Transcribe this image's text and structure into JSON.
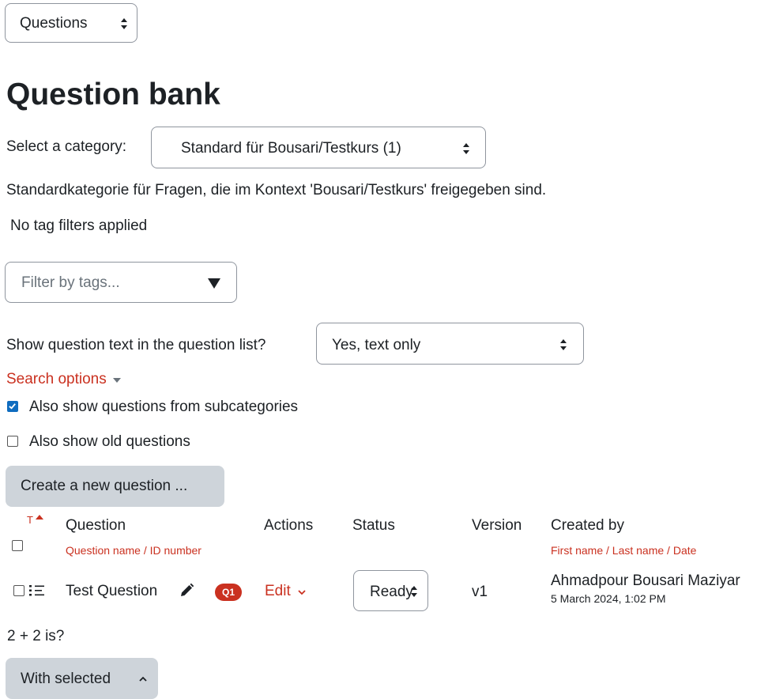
{
  "nav_select": {
    "value": "Questions"
  },
  "page_title": "Question bank",
  "category": {
    "label": "Select a category:",
    "value": "Standard für Bousari/Testkurs (1)",
    "description": "Standardkategorie für Fragen, die im Kontext 'Bousari/Testkurs' freigegeben sind."
  },
  "tags": {
    "status": "No tag filters applied",
    "placeholder": "Filter by tags..."
  },
  "show_text": {
    "label": "Show question text in the question list?",
    "value": "Yes, text only"
  },
  "search_options": {
    "label": "Search options"
  },
  "options": {
    "subcategories": {
      "label": "Also show questions from subcategories",
      "checked": true
    },
    "old_questions": {
      "label": "Also show old questions",
      "checked": false
    }
  },
  "create_button": {
    "label": "Create a new question ..."
  },
  "table": {
    "headers": {
      "type_sort": "T",
      "question": "Question",
      "question_sub": "Question name / ID number",
      "actions": "Actions",
      "status": "Status",
      "version": "Version",
      "created_by": "Created by",
      "created_by_sub": "First name / Last name / Date"
    },
    "rows": [
      {
        "name": "Test Question",
        "badge": "Q1",
        "action": "Edit",
        "status": "Ready",
        "version": "v1",
        "creator": "Ahmadpour Bousari Maziyar",
        "date": "5 March 2024, 1:02 PM",
        "text": "2 + 2 is?"
      }
    ]
  },
  "with_selected": {
    "label": "With selected"
  },
  "colors": {
    "accent_red": "#ca3120",
    "checkbox_blue": "#0f6cbf",
    "button_grey": "#ced4da"
  }
}
